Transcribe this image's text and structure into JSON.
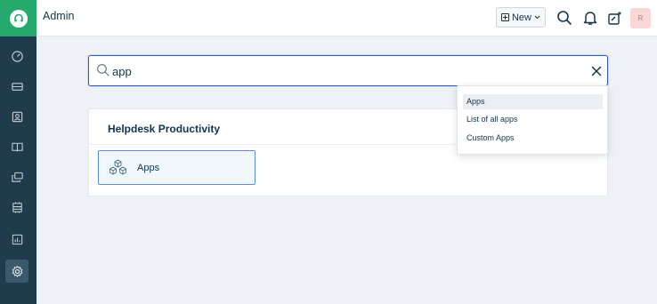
{
  "header": {
    "title": "Admin",
    "new_label": "New",
    "avatar_initial": "R"
  },
  "search": {
    "value": "app",
    "placeholder": ""
  },
  "results": {
    "section_title": "Helpdesk Productivity",
    "items": [
      {
        "label": "Apps"
      }
    ]
  },
  "suggestions": [
    {
      "label": "Apps",
      "highlighted": true
    },
    {
      "label": "List of all apps",
      "highlighted": false
    },
    {
      "label": "Custom Apps",
      "highlighted": false
    }
  ],
  "sidebar": {
    "items": [
      {
        "icon": "dashboard-icon"
      },
      {
        "icon": "tickets-icon"
      },
      {
        "icon": "contacts-icon"
      },
      {
        "icon": "solutions-icon"
      },
      {
        "icon": "forums-icon"
      },
      {
        "icon": "assets-icon"
      },
      {
        "icon": "reports-icon"
      },
      {
        "icon": "admin-settings-icon",
        "active": true
      }
    ]
  },
  "colors": {
    "sidebar_bg": "#203c4c",
    "logo_bg": "#26a96c",
    "accent": "#2c5cc5",
    "page_bg": "#eef1f5"
  }
}
